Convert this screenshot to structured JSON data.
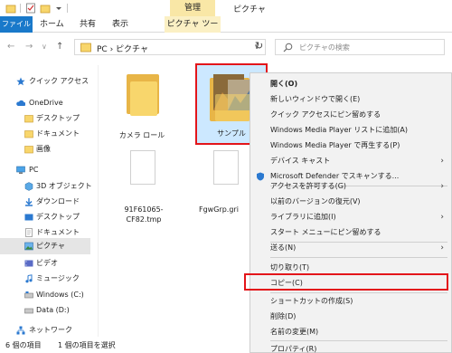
{
  "titlebar": {
    "context_tab": "管理",
    "window_title": "ピクチャ"
  },
  "ribbon": {
    "file": "ファイル",
    "home": "ホーム",
    "share": "共有",
    "view": "表示",
    "picture_tools": "ピクチャ ツール"
  },
  "nav_buttons": {
    "back": "←",
    "forward": "→",
    "dropdown": "∨",
    "up": "↑",
    "refresh": "↻"
  },
  "address": {
    "path": "PC › ピクチャ",
    "chevron": "∨"
  },
  "search": {
    "placeholder": "ピクチャの検索"
  },
  "navpane": {
    "items": [
      {
        "label": "クイック アクセス"
      },
      {
        "label": "OneDrive"
      },
      {
        "label": "デスクトップ"
      },
      {
        "label": "ドキュメント"
      },
      {
        "label": "画像"
      },
      {
        "label": "PC"
      },
      {
        "label": "3D オブジェクト"
      },
      {
        "label": "ダウンロード"
      },
      {
        "label": "デスクトップ"
      },
      {
        "label": "ドキュメント"
      },
      {
        "label": "ピクチャ"
      },
      {
        "label": "ビデオ"
      },
      {
        "label": "ミュージック"
      },
      {
        "label": "Windows (C:)"
      },
      {
        "label": "Data (D:)"
      },
      {
        "label": "ネットワーク"
      }
    ]
  },
  "files": [
    {
      "label": "カメラ ロール"
    },
    {
      "label": "サンプル"
    },
    {
      "label": "91F61065-CF82.tmp"
    },
    {
      "label": "FgwGrp.gri"
    }
  ],
  "status": {
    "count": "6 個の項目",
    "selected": "1 個の項目を選択"
  },
  "menu": {
    "items": [
      {
        "label": "開く(O)"
      },
      {
        "label": "新しいウィンドウで開く(E)"
      },
      {
        "label": "クイック アクセスにピン留めする"
      },
      {
        "label": "Windows Media Player リストに追加(A)"
      },
      {
        "label": "Windows Media Player で再生する(P)"
      },
      {
        "label": "デバイス キャスト"
      },
      {
        "label": "Microsoft Defender でスキャンする..."
      },
      {
        "label": "アクセスを許可する(G)"
      },
      {
        "label": "以前のバージョンの復元(V)"
      },
      {
        "label": "ライブラリに追加(I)"
      },
      {
        "label": "スタート メニューにピン留めする"
      },
      {
        "label": "送る(N)"
      },
      {
        "label": "切り取り(T)"
      },
      {
        "label": "コピー(C)"
      },
      {
        "label": "ショートカットの作成(S)"
      },
      {
        "label": "削除(D)"
      },
      {
        "label": "名前の変更(M)"
      },
      {
        "label": "プロパティ(R)"
      }
    ],
    "submenu_arrow": "›"
  },
  "colors": {
    "accent": "#1979ca",
    "highlight": "#e3151a",
    "selection": "#cce8ff",
    "folder": "#f8d66c"
  }
}
